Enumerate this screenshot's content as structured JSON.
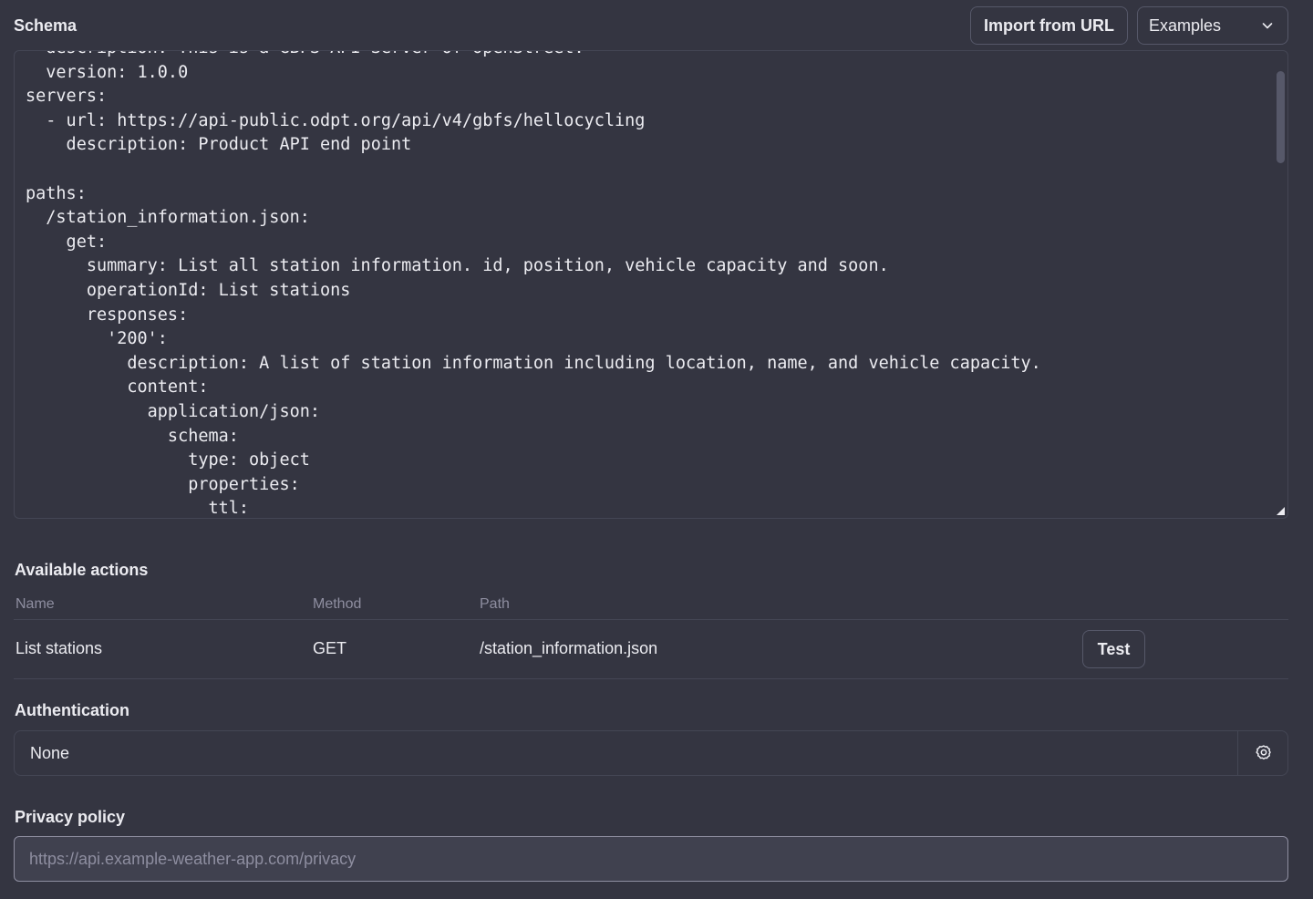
{
  "schema": {
    "label": "Schema",
    "import_label": "Import from URL",
    "examples_label": "Examples",
    "code_lines": [
      "  description: This is a GBFS API Server of OpenStreet.",
      "  version: 1.0.0",
      "servers:",
      "  - url: https://api-public.odpt.org/api/v4/gbfs/hellocycling",
      "    description: Product API end point",
      "",
      "paths:",
      "  /station_information.json:",
      "    get:",
      "      summary: List all station information. id, position, vehicle capacity and soon.",
      "      operationId: List stations",
      "      responses:",
      "        '200':",
      "          description: A list of station information including location, name, and vehicle capacity.",
      "          content:",
      "            application/json:",
      "              schema:",
      "                type: object",
      "                properties:",
      "                  ttl:"
    ]
  },
  "actions": {
    "title": "Available actions",
    "columns": {
      "name": "Name",
      "method": "Method",
      "path": "Path"
    },
    "rows": [
      {
        "name": "List stations",
        "method": "GET",
        "path": "/station_information.json",
        "test_label": "Test"
      }
    ]
  },
  "auth": {
    "title": "Authentication",
    "value": "None"
  },
  "privacy": {
    "title": "Privacy policy",
    "placeholder": "https://api.example-weather-app.com/privacy"
  },
  "colors": {
    "background": "#343541",
    "border": "#444654",
    "text": "#ececf1",
    "muted": "#8e8ea0"
  }
}
